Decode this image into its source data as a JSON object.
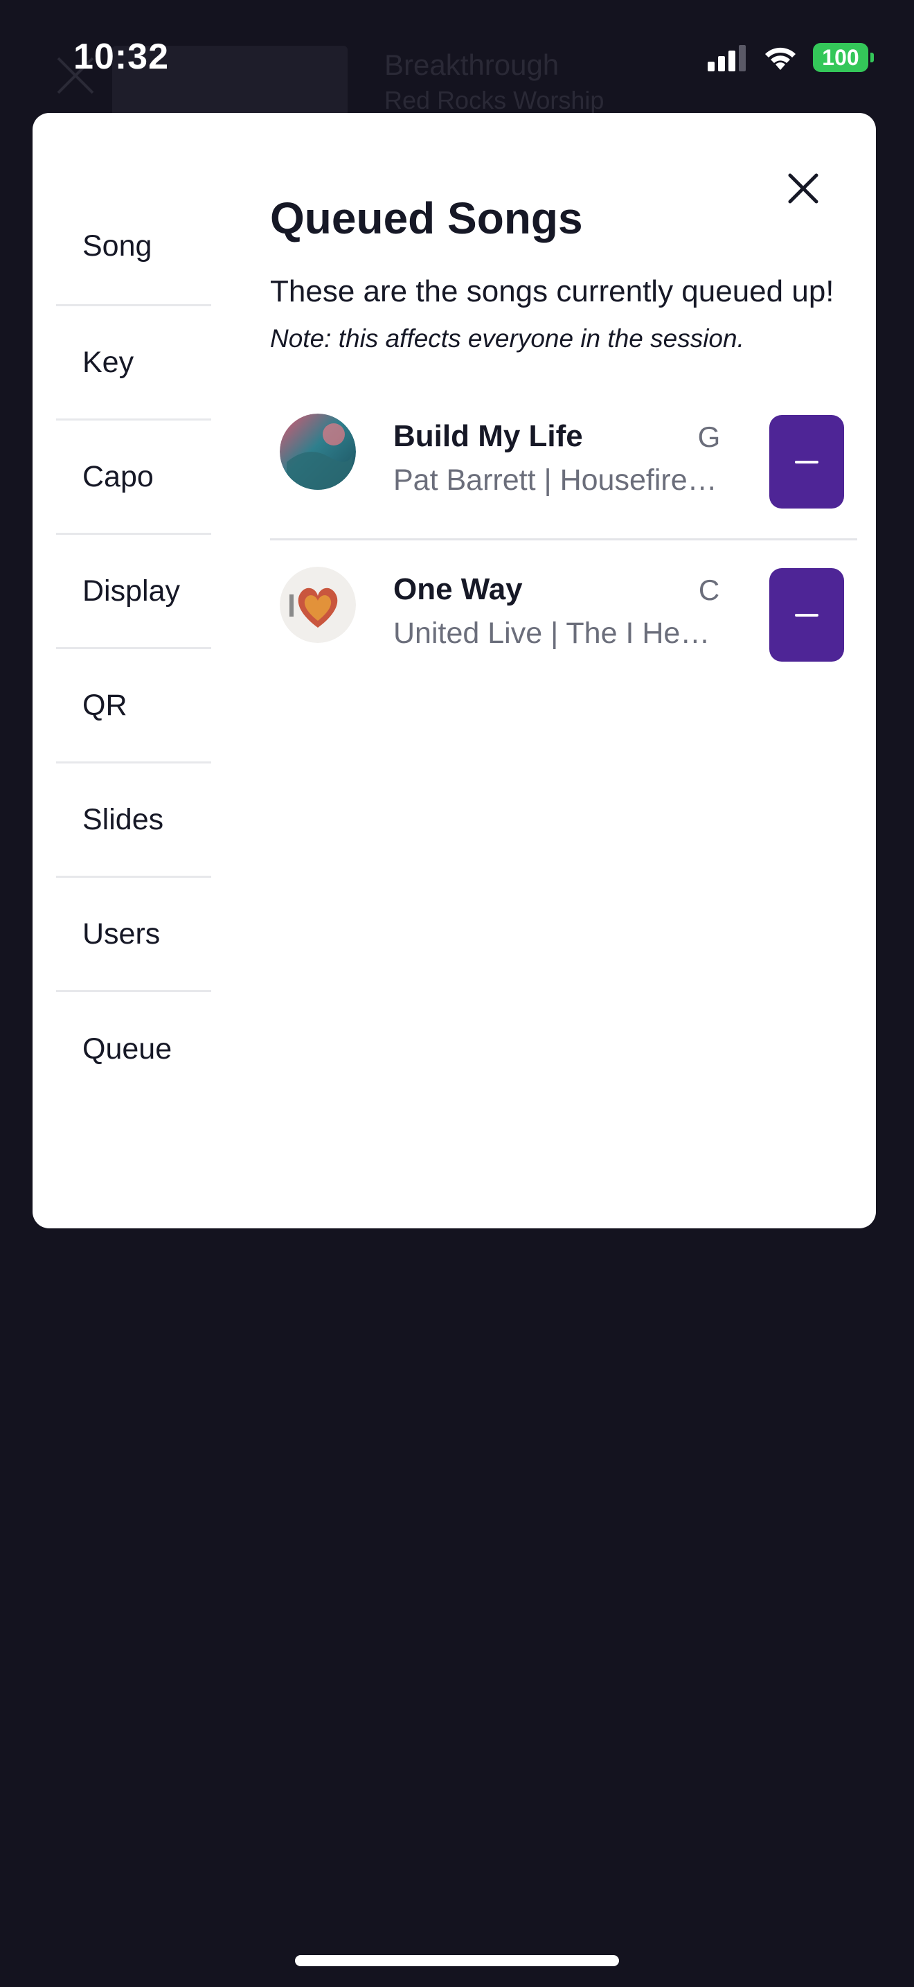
{
  "status_bar": {
    "time": "10:32",
    "battery": "100",
    "signal_icon": "cellular-signal-icon",
    "wifi_icon": "wifi-icon"
  },
  "background": {
    "song_title": "Breakthrough",
    "song_artist": "Red Rocks Worship"
  },
  "sidebar": {
    "items": [
      {
        "label": "Song"
      },
      {
        "label": "Key"
      },
      {
        "label": "Capo"
      },
      {
        "label": "Display"
      },
      {
        "label": "QR"
      },
      {
        "label": "Slides"
      },
      {
        "label": "Users"
      },
      {
        "label": "Queue"
      }
    ]
  },
  "main": {
    "title": "Queued Songs",
    "subtitle": "These are the songs currently queued up!",
    "note": "Note: this affects everyone in the session.",
    "songs": [
      {
        "title": "Build My Life",
        "artist": "Pat Barrett | Housefire…",
        "key": "G"
      },
      {
        "title": "One Way",
        "artist": "United Live | The I He…",
        "key": "C"
      }
    ]
  },
  "colors": {
    "backdrop": "#14131f",
    "card": "#ffffff",
    "accent": "#4e2596",
    "text": "#161826",
    "muted": "#6b6e7b",
    "battery": "#34c759"
  }
}
